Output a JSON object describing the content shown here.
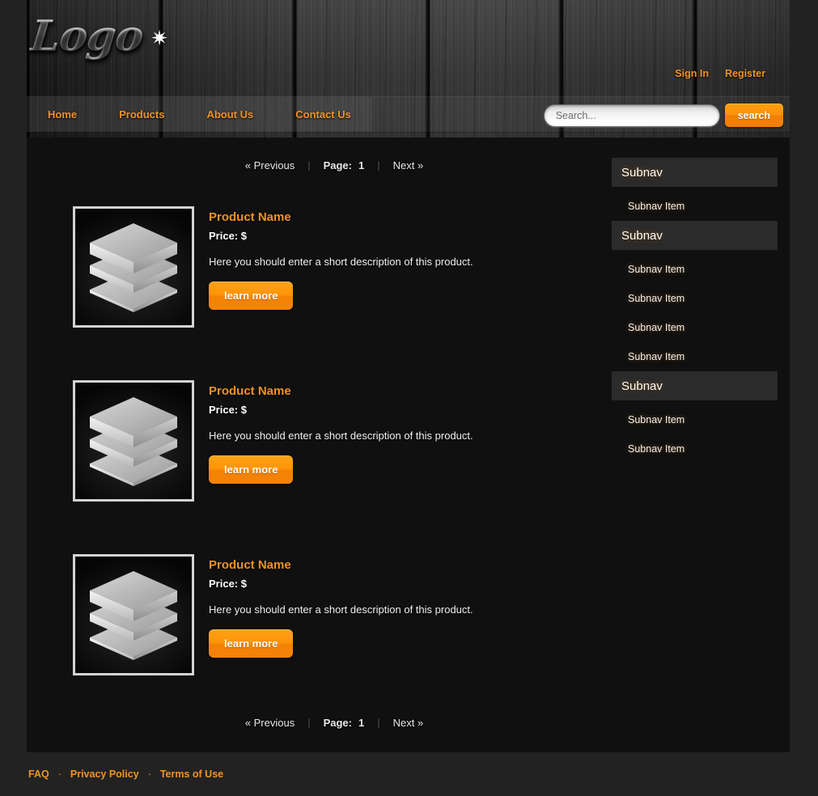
{
  "header": {
    "logo_text": "Logo",
    "logo_star_icon": "starburst-icon",
    "account_links": [
      {
        "label": "Sign In"
      },
      {
        "label": "Register"
      }
    ]
  },
  "nav": {
    "items": [
      {
        "label": "Home"
      },
      {
        "label": "Products"
      },
      {
        "label": "About Us"
      },
      {
        "label": "Contact Us"
      }
    ]
  },
  "search": {
    "placeholder": "Search...",
    "value": "",
    "button_label": "search"
  },
  "pagination": {
    "previous_label": "« Previous",
    "page_label": "Page:",
    "page_number": "1",
    "next_label": "Next »",
    "separator": "|"
  },
  "products": [
    {
      "title": "Product Name",
      "price": "Price: $",
      "description": "Here you should enter a short description of this product.",
      "button_label": "learn more",
      "thumbnail_icon": "stacked-layers-icon"
    },
    {
      "title": "Product Name",
      "price": "Price: $",
      "description": "Here you should enter a short description of this product.",
      "button_label": "learn more",
      "thumbnail_icon": "stacked-layers-icon"
    },
    {
      "title": "Product Name",
      "price": "Price: $",
      "description": "Here you should enter a short description of this product.",
      "button_label": "learn more",
      "thumbnail_icon": "stacked-layers-icon"
    }
  ],
  "sidebar": {
    "groups": [
      {
        "header": "Subnav",
        "items": [
          {
            "label": "Subnav Item"
          }
        ]
      },
      {
        "header": "Subnav",
        "items": [
          {
            "label": "Subnav Item"
          },
          {
            "label": "Subnav Item"
          },
          {
            "label": "Subnav Item"
          },
          {
            "label": "Subnav Item"
          }
        ]
      },
      {
        "header": "Subnav",
        "items": [
          {
            "label": "Subnav Item"
          },
          {
            "label": "Subnav Item"
          }
        ]
      }
    ]
  },
  "footer": {
    "separator": "·",
    "links": [
      {
        "label": "FAQ"
      },
      {
        "label": "Privacy Policy"
      },
      {
        "label": "Terms of Use"
      }
    ]
  },
  "colors": {
    "accent_orange": "#ef9325",
    "button_orange": "#fb9209",
    "page_background": "#222222",
    "content_background": "#101010",
    "subnav_header_background": "#2b2b2b"
  }
}
